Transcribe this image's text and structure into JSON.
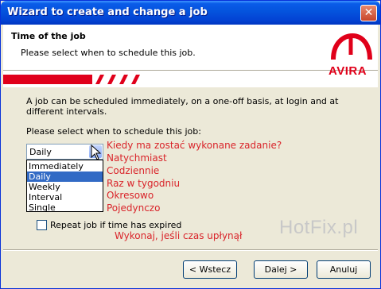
{
  "window": {
    "title": "Wizard to create and change a job",
    "close_glyph": "✕"
  },
  "header": {
    "title": "Time of the job",
    "subtitle": "Please select when to schedule this job.",
    "logo_text": "AVIRA",
    "accent_color": "#e0001a"
  },
  "main": {
    "description": "A job can be scheduled immediately, on a one-off basis, at login and at different intervals.",
    "select_label": "Please select when to schedule this job:",
    "dropdown_value": "Daily",
    "options": [
      "Immediately",
      "Daily",
      "Weekly",
      "Interval",
      "Single"
    ],
    "selected_option": "Daily",
    "repeat_label": "Repeat job if time has expired",
    "repeat_checked": false
  },
  "annotations": {
    "question": "Kiedy ma zostać wykonane zadanie?",
    "opt1": "Natychmiast",
    "opt2": "Codziennie",
    "opt3": "Raz w tygodniu",
    "opt4": "Okresowo",
    "opt5": "Pojedynczo",
    "repeat": "Wykonaj, jeśli czas upłynął"
  },
  "watermark": "HotFix.pl",
  "footer": {
    "back_label": "< Wstecz",
    "next_label": "Dalej >",
    "cancel_label": "Anuluj"
  }
}
